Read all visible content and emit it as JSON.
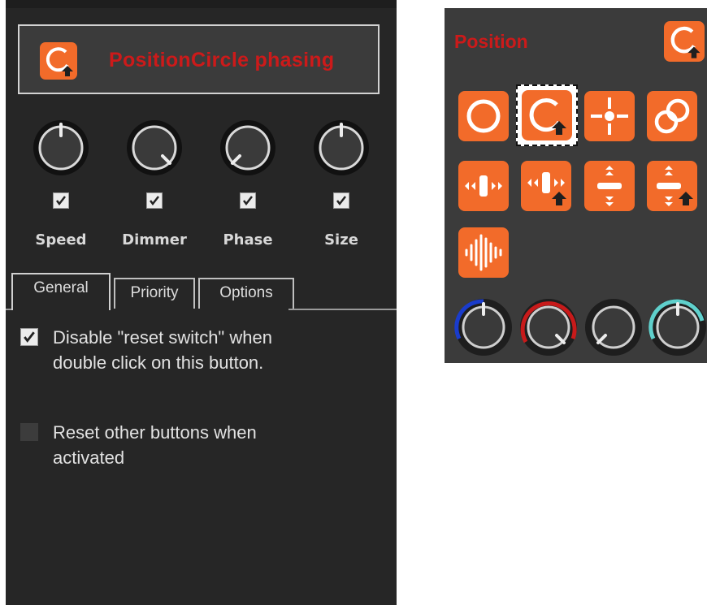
{
  "left_panel": {
    "title": "PositionCircle phasing",
    "title_icon": "circle-phase-arrow-icon",
    "knobs": [
      {
        "label": "Speed",
        "checked": true
      },
      {
        "label": "Dimmer",
        "checked": true
      },
      {
        "label": "Phase",
        "checked": true
      },
      {
        "label": "Size",
        "checked": true
      }
    ],
    "tabs": [
      "General",
      "Priority",
      "Options"
    ],
    "active_tab": "General",
    "options": [
      {
        "text": "Disable \"reset switch\" when double click on this button.",
        "checked": true
      },
      {
        "text": "Reset other buttons when activated",
        "checked": false
      }
    ]
  },
  "right_panel": {
    "title": "Position",
    "top_icon": "circle-phase-arrow-icon",
    "tiles": [
      {
        "icon": "circle-icon",
        "selected": false
      },
      {
        "icon": "circle-phase-arrow-icon",
        "selected": true
      },
      {
        "icon": "crosshair-icon",
        "selected": false
      },
      {
        "icon": "double-circle-icon",
        "selected": false
      },
      {
        "icon": "horizontal-sweep-icon",
        "selected": false
      },
      {
        "icon": "horizontal-sweep-arrow-icon",
        "selected": false
      },
      {
        "icon": "vertical-sweep-icon",
        "selected": false
      },
      {
        "icon": "vertical-sweep-arrow-icon",
        "selected": false
      },
      {
        "icon": "waveform-icon",
        "selected": false
      }
    ],
    "knob_ring_colors": [
      "#1a3ccc",
      "#c81a1a",
      "#1e1e1e",
      "#5fd0cc"
    ]
  },
  "colors": {
    "accent_orange": "#f26b2a",
    "title_red": "#cc1a1a",
    "panel_dark": "#262626",
    "panel_mid": "#3b3b3b"
  }
}
